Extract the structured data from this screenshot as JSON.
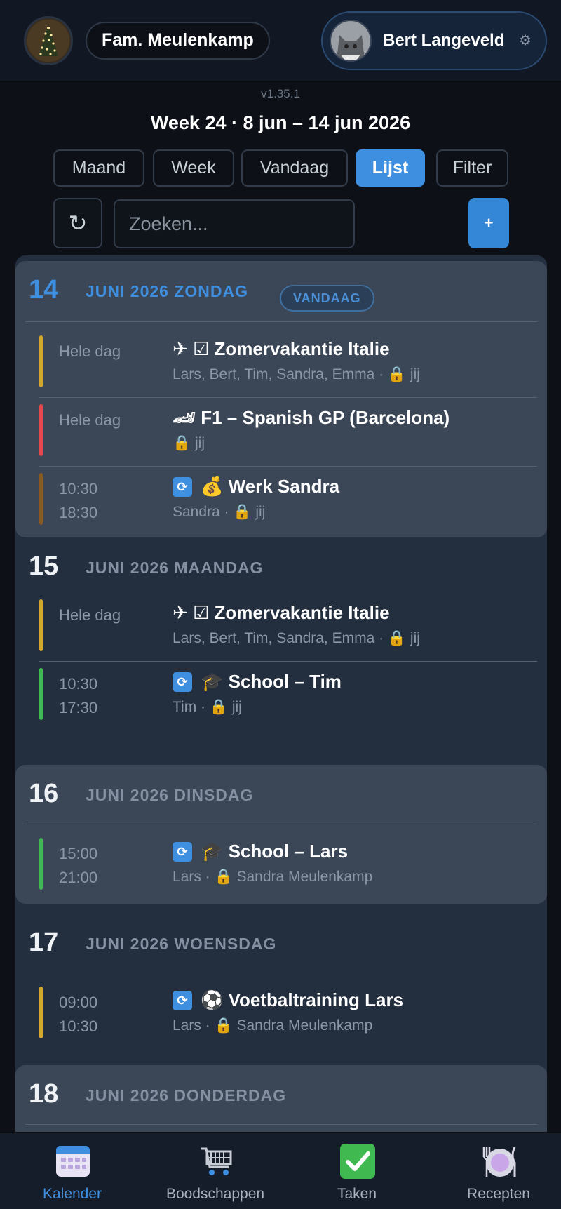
{
  "header": {
    "family_name": "Fam. Meulenkamp",
    "user_name": "Bert Langeveld",
    "settings_icon": "gear-icon"
  },
  "version": "v1.35.1",
  "week_title": "Week 24 · 8 jun – 14 jun 2026",
  "tabs": [
    {
      "label": "Maand",
      "active": false
    },
    {
      "label": "Week",
      "active": false
    },
    {
      "label": "Vandaag",
      "active": false
    },
    {
      "label": "Lijst",
      "active": true
    },
    {
      "label": "Filter",
      "active": false
    }
  ],
  "refresh_icon": "↻",
  "search": {
    "placeholder": "Zoeken..."
  },
  "add_label": "+",
  "days": [
    {
      "num": "14",
      "label": "JUNI 2026 ZONDAG",
      "badge": "VANDAAG",
      "events": [
        {
          "time1": "Hele dag",
          "time2": "",
          "title": "✈ ☑ Zomervakantie Italie",
          "meta": "Lars, Bert, Tim, Sandra, Emma · 🔒 jij",
          "color": "#d4a72c"
        },
        {
          "time1": "Hele dag",
          "time2": "",
          "title": "🏎 F1 – Spanish GP (Barcelona)",
          "meta": "🔒 jij",
          "color": "#e5484d"
        },
        {
          "time1": "10:30",
          "time2": "18:30",
          "title": "💰 Werk Sandra",
          "meta": "Sandra · 🔒 jij",
          "color": "#8a5a22",
          "sync": true
        }
      ]
    },
    {
      "num": "15",
      "label": "JUNI 2026 MAANDAG",
      "events": [
        {
          "time1": "Hele dag",
          "time2": "",
          "title": "✈ ☑ Zomervakantie Italie",
          "meta": "Lars, Bert, Tim, Sandra, Emma · 🔒 jij",
          "color": "#d4a72c"
        },
        {
          "time1": "10:30",
          "time2": "17:30",
          "title": "🎓 School – Tim",
          "meta": "Tim · 🔒 jij",
          "color": "#3fb950",
          "sync": true
        }
      ]
    },
    {
      "num": "16",
      "label": "JUNI 2026 DINSDAG",
      "events": [
        {
          "time1": "15:00",
          "time2": "21:00",
          "title": "🎓 School – Lars",
          "meta": "Lars · 🔒 Sandra Meulenkamp",
          "color": "#3fb950",
          "sync": true
        }
      ]
    },
    {
      "num": "17",
      "label": "JUNI 2026 WOENSDAG",
      "events": [
        {
          "time1": "09:00",
          "time2": "10:30",
          "title": "⚽ Voetbaltraining Lars",
          "meta": "Lars · 🔒 Sandra Meulenkamp",
          "color": "#d4a72c",
          "sync": true
        }
      ]
    },
    {
      "num": "18",
      "label": "JUNI 2026 DONDERDAG",
      "events": []
    }
  ],
  "nav": [
    {
      "label": "Kalender",
      "icon": "calendar-icon",
      "active": true
    },
    {
      "label": "Boodschappen",
      "icon": "shopping-cart-icon",
      "active": false
    },
    {
      "label": "Taken",
      "icon": "checkmark-icon",
      "active": false
    },
    {
      "label": "Recepten",
      "icon": "plate-icon",
      "active": false
    }
  ]
}
